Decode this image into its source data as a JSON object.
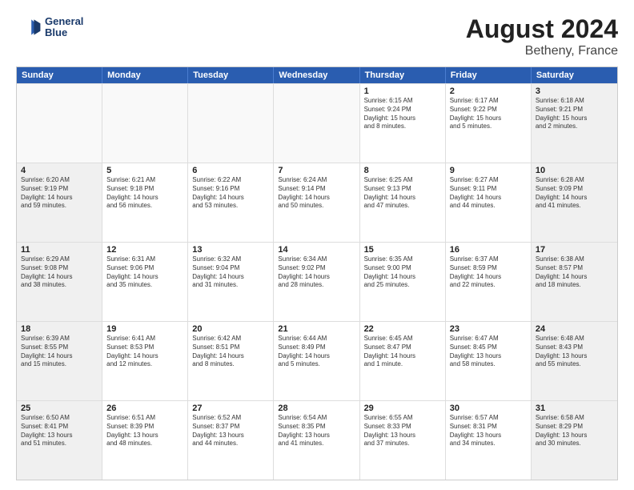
{
  "header": {
    "logo_line1": "General",
    "logo_line2": "Blue",
    "title": "August 2024",
    "subtitle": "Betheny, France"
  },
  "days_of_week": [
    "Sunday",
    "Monday",
    "Tuesday",
    "Wednesday",
    "Thursday",
    "Friday",
    "Saturday"
  ],
  "rows": [
    [
      {
        "day": "",
        "empty": true
      },
      {
        "day": "",
        "empty": true
      },
      {
        "day": "",
        "empty": true
      },
      {
        "day": "",
        "empty": true
      },
      {
        "day": "1",
        "lines": [
          "Sunrise: 6:15 AM",
          "Sunset: 9:24 PM",
          "Daylight: 15 hours",
          "and 8 minutes."
        ]
      },
      {
        "day": "2",
        "lines": [
          "Sunrise: 6:17 AM",
          "Sunset: 9:22 PM",
          "Daylight: 15 hours",
          "and 5 minutes."
        ]
      },
      {
        "day": "3",
        "shaded": true,
        "lines": [
          "Sunrise: 6:18 AM",
          "Sunset: 9:21 PM",
          "Daylight: 15 hours",
          "and 2 minutes."
        ]
      }
    ],
    [
      {
        "day": "4",
        "shaded": true,
        "lines": [
          "Sunrise: 6:20 AM",
          "Sunset: 9:19 PM",
          "Daylight: 14 hours",
          "and 59 minutes."
        ]
      },
      {
        "day": "5",
        "lines": [
          "Sunrise: 6:21 AM",
          "Sunset: 9:18 PM",
          "Daylight: 14 hours",
          "and 56 minutes."
        ]
      },
      {
        "day": "6",
        "lines": [
          "Sunrise: 6:22 AM",
          "Sunset: 9:16 PM",
          "Daylight: 14 hours",
          "and 53 minutes."
        ]
      },
      {
        "day": "7",
        "lines": [
          "Sunrise: 6:24 AM",
          "Sunset: 9:14 PM",
          "Daylight: 14 hours",
          "and 50 minutes."
        ]
      },
      {
        "day": "8",
        "lines": [
          "Sunrise: 6:25 AM",
          "Sunset: 9:13 PM",
          "Daylight: 14 hours",
          "and 47 minutes."
        ]
      },
      {
        "day": "9",
        "lines": [
          "Sunrise: 6:27 AM",
          "Sunset: 9:11 PM",
          "Daylight: 14 hours",
          "and 44 minutes."
        ]
      },
      {
        "day": "10",
        "shaded": true,
        "lines": [
          "Sunrise: 6:28 AM",
          "Sunset: 9:09 PM",
          "Daylight: 14 hours",
          "and 41 minutes."
        ]
      }
    ],
    [
      {
        "day": "11",
        "shaded": true,
        "lines": [
          "Sunrise: 6:29 AM",
          "Sunset: 9:08 PM",
          "Daylight: 14 hours",
          "and 38 minutes."
        ]
      },
      {
        "day": "12",
        "lines": [
          "Sunrise: 6:31 AM",
          "Sunset: 9:06 PM",
          "Daylight: 14 hours",
          "and 35 minutes."
        ]
      },
      {
        "day": "13",
        "lines": [
          "Sunrise: 6:32 AM",
          "Sunset: 9:04 PM",
          "Daylight: 14 hours",
          "and 31 minutes."
        ]
      },
      {
        "day": "14",
        "lines": [
          "Sunrise: 6:34 AM",
          "Sunset: 9:02 PM",
          "Daylight: 14 hours",
          "and 28 minutes."
        ]
      },
      {
        "day": "15",
        "lines": [
          "Sunrise: 6:35 AM",
          "Sunset: 9:00 PM",
          "Daylight: 14 hours",
          "and 25 minutes."
        ]
      },
      {
        "day": "16",
        "lines": [
          "Sunrise: 6:37 AM",
          "Sunset: 8:59 PM",
          "Daylight: 14 hours",
          "and 22 minutes."
        ]
      },
      {
        "day": "17",
        "shaded": true,
        "lines": [
          "Sunrise: 6:38 AM",
          "Sunset: 8:57 PM",
          "Daylight: 14 hours",
          "and 18 minutes."
        ]
      }
    ],
    [
      {
        "day": "18",
        "shaded": true,
        "lines": [
          "Sunrise: 6:39 AM",
          "Sunset: 8:55 PM",
          "Daylight: 14 hours",
          "and 15 minutes."
        ]
      },
      {
        "day": "19",
        "lines": [
          "Sunrise: 6:41 AM",
          "Sunset: 8:53 PM",
          "Daylight: 14 hours",
          "and 12 minutes."
        ]
      },
      {
        "day": "20",
        "lines": [
          "Sunrise: 6:42 AM",
          "Sunset: 8:51 PM",
          "Daylight: 14 hours",
          "and 8 minutes."
        ]
      },
      {
        "day": "21",
        "lines": [
          "Sunrise: 6:44 AM",
          "Sunset: 8:49 PM",
          "Daylight: 14 hours",
          "and 5 minutes."
        ]
      },
      {
        "day": "22",
        "lines": [
          "Sunrise: 6:45 AM",
          "Sunset: 8:47 PM",
          "Daylight: 14 hours",
          "and 1 minute."
        ]
      },
      {
        "day": "23",
        "lines": [
          "Sunrise: 6:47 AM",
          "Sunset: 8:45 PM",
          "Daylight: 13 hours",
          "and 58 minutes."
        ]
      },
      {
        "day": "24",
        "shaded": true,
        "lines": [
          "Sunrise: 6:48 AM",
          "Sunset: 8:43 PM",
          "Daylight: 13 hours",
          "and 55 minutes."
        ]
      }
    ],
    [
      {
        "day": "25",
        "shaded": true,
        "lines": [
          "Sunrise: 6:50 AM",
          "Sunset: 8:41 PM",
          "Daylight: 13 hours",
          "and 51 minutes."
        ]
      },
      {
        "day": "26",
        "lines": [
          "Sunrise: 6:51 AM",
          "Sunset: 8:39 PM",
          "Daylight: 13 hours",
          "and 48 minutes."
        ]
      },
      {
        "day": "27",
        "lines": [
          "Sunrise: 6:52 AM",
          "Sunset: 8:37 PM",
          "Daylight: 13 hours",
          "and 44 minutes."
        ]
      },
      {
        "day": "28",
        "lines": [
          "Sunrise: 6:54 AM",
          "Sunset: 8:35 PM",
          "Daylight: 13 hours",
          "and 41 minutes."
        ]
      },
      {
        "day": "29",
        "lines": [
          "Sunrise: 6:55 AM",
          "Sunset: 8:33 PM",
          "Daylight: 13 hours",
          "and 37 minutes."
        ]
      },
      {
        "day": "30",
        "lines": [
          "Sunrise: 6:57 AM",
          "Sunset: 8:31 PM",
          "Daylight: 13 hours",
          "and 34 minutes."
        ]
      },
      {
        "day": "31",
        "shaded": true,
        "lines": [
          "Sunrise: 6:58 AM",
          "Sunset: 8:29 PM",
          "Daylight: 13 hours",
          "and 30 minutes."
        ]
      }
    ]
  ]
}
